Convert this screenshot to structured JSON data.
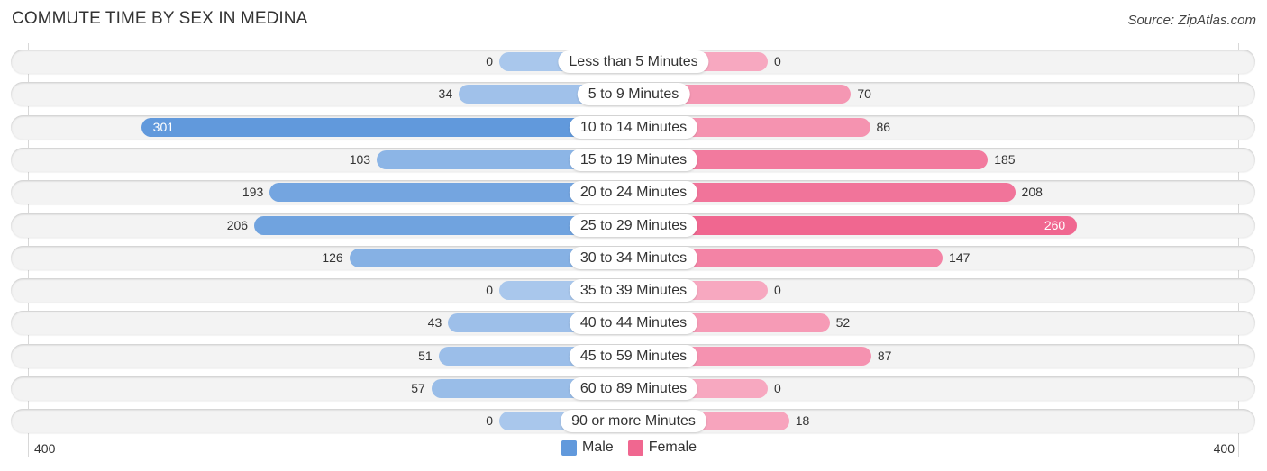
{
  "header": {
    "title": "COMMUTE TIME BY SEX IN MEDINA",
    "source": "Source: ZipAtlas.com"
  },
  "colors": {
    "male_strong": "#6199dc",
    "male_light": "#a9c7ec",
    "female_strong": "#f06790",
    "female_light": "#f7a8c0",
    "track": "#f3f3f3"
  },
  "chart_data": {
    "type": "bar",
    "orientation": "horizontal-diverging",
    "title": "COMMUTE TIME BY SEX IN MEDINA",
    "categories": [
      "Less than 5 Minutes",
      "5 to 9 Minutes",
      "10 to 14 Minutes",
      "15 to 19 Minutes",
      "20 to 24 Minutes",
      "25 to 29 Minutes",
      "30 to 34 Minutes",
      "35 to 39 Minutes",
      "40 to 44 Minutes",
      "45 to 59 Minutes",
      "60 to 89 Minutes",
      "90 or more Minutes"
    ],
    "series": [
      {
        "name": "Male",
        "values": [
          0,
          34,
          301,
          103,
          193,
          206,
          126,
          0,
          43,
          51,
          57,
          0
        ]
      },
      {
        "name": "Female",
        "values": [
          0,
          70,
          86,
          185,
          208,
          260,
          147,
          0,
          52,
          87,
          0,
          18
        ]
      }
    ],
    "axis": {
      "left_label": "400",
      "right_label": "400",
      "range": [
        -400,
        400
      ]
    },
    "legend": {
      "position": "bottom-center",
      "items": [
        "Male",
        "Female"
      ]
    }
  }
}
